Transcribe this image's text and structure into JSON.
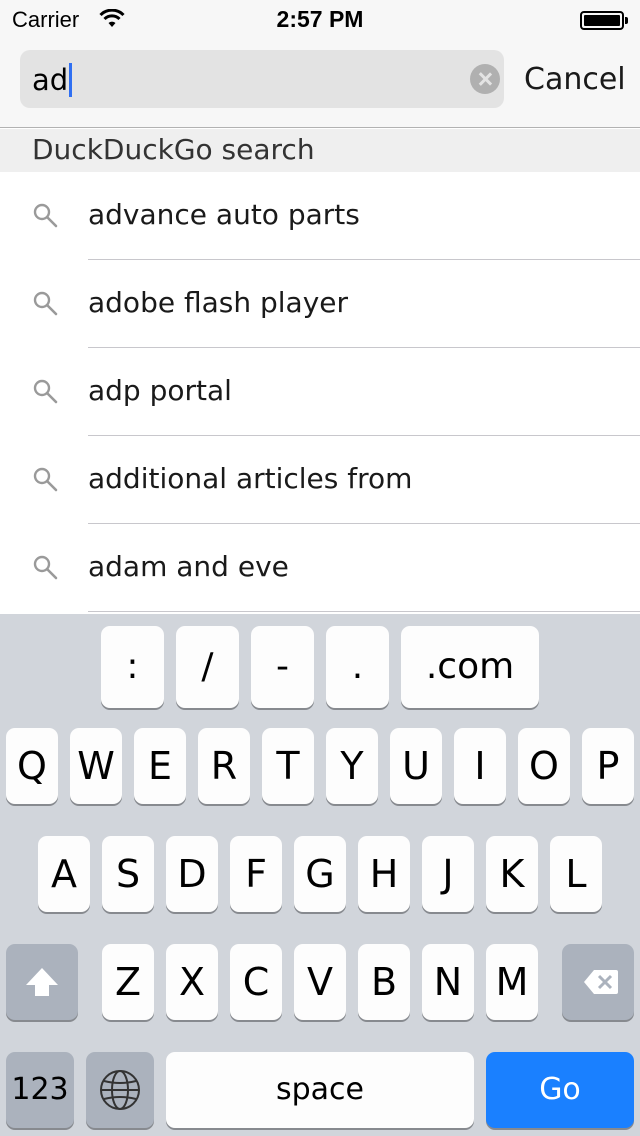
{
  "status_bar": {
    "carrier": "Carrier",
    "time": "2:57 PM"
  },
  "search": {
    "value": "ad",
    "cancel_label": "Cancel"
  },
  "section_header": "DuckDuckGo search",
  "suggestions": [
    "advance auto parts",
    "adobe flash player",
    "adp portal",
    "additional articles from",
    "adam and eve"
  ],
  "keyboard": {
    "shortcut_keys": [
      ":",
      "/",
      "-",
      ".",
      ".com"
    ],
    "row1": [
      "Q",
      "W",
      "E",
      "R",
      "T",
      "Y",
      "U",
      "I",
      "O",
      "P"
    ],
    "row2": [
      "A",
      "S",
      "D",
      "F",
      "G",
      "H",
      "J",
      "K",
      "L"
    ],
    "row3": [
      "Z",
      "X",
      "C",
      "V",
      "B",
      "N",
      "M"
    ],
    "numbers_label": "123",
    "space_label": "space",
    "go_label": "Go"
  },
  "colors": {
    "caret": "#2f6ff2",
    "go_key": "#1a80ff",
    "keyboard_bg": "#d1d5db"
  }
}
